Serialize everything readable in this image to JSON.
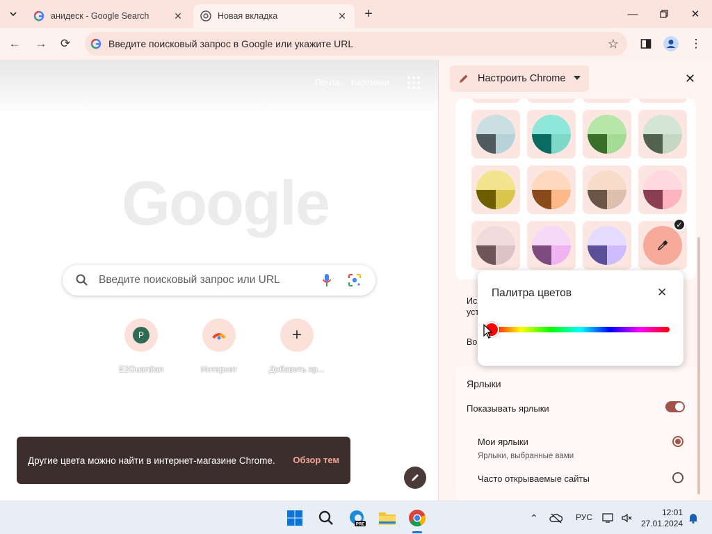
{
  "browser": {
    "tabs": [
      {
        "title": "анидеск - Google Search",
        "active": false
      },
      {
        "title": "Новая вкладка",
        "active": true
      }
    ],
    "omnibox_text": "Введите поисковый запрос в Google или укажите URL"
  },
  "ntp": {
    "top_links": [
      "Почта",
      "Картинки"
    ],
    "logo": "Google",
    "search_placeholder": "Введите поисковый запрос или URL",
    "shortcuts": [
      {
        "label": "E2Guardian",
        "badge": "P"
      },
      {
        "label": "Интернет"
      },
      {
        "label": "Добавить яр..."
      }
    ],
    "snackbar": {
      "text": "Другие цвета можно найти в интернет-магазине Chrome.",
      "action": "Обзор тем"
    }
  },
  "side_panel": {
    "title": "Настроить Chrome",
    "swatch_rows": [
      [
        {
          "top": "#c9dfe3",
          "bl": "#4f5b5e",
          "br": "#b7d3d9"
        },
        {
          "top": "#8fe7d9",
          "bl": "#0a6b63",
          "br": "#7dd8c8"
        },
        {
          "top": "#b6e7a9",
          "bl": "#3a6f2a",
          "br": "#a4dc94"
        },
        {
          "top": "#d5e5d3",
          "bl": "#53614f",
          "br": "#c5d7c2"
        }
      ],
      [
        {
          "top": "#f2e58e",
          "bl": "#6d5f00",
          "br": "#dbc64d"
        },
        {
          "top": "#ffd8bd",
          "bl": "#8a4a1c",
          "br": "#ffb887"
        },
        {
          "top": "#f6dcc9",
          "bl": "#6b5546",
          "br": "#dcc0ad"
        },
        {
          "top": "#ffd9df",
          "bl": "#8b3f50",
          "br": "#ffb4c0"
        }
      ],
      [
        {
          "top": "#f1dadc",
          "bl": "#6f5557",
          "br": "#ddc3c6"
        },
        {
          "top": "#f7d9f7",
          "bl": "#7d4b7e",
          "br": "#f2b3f3"
        },
        {
          "top": "#e5ddff",
          "bl": "#5c4f99",
          "br": "#cdbcff"
        }
      ]
    ],
    "custom_color": "#f7a99a",
    "partial_labels": [
      "Ис",
      "уст",
      "Во"
    ],
    "shortcuts_section": {
      "title": "Ярлыки",
      "show_label": "Показывать ярлыки",
      "options": [
        {
          "label": "Мои ярлыки",
          "sub": "Ярлыки, выбранные вами",
          "selected": true
        },
        {
          "label": "Часто открываемые сайты",
          "selected": false
        }
      ]
    }
  },
  "color_picker": {
    "title": "Палитра цветов",
    "selected_hue_color": "#ff0000"
  },
  "taskbar": {
    "tray_lang": "РУС",
    "time": "12:01",
    "date": "27.01.2024"
  }
}
